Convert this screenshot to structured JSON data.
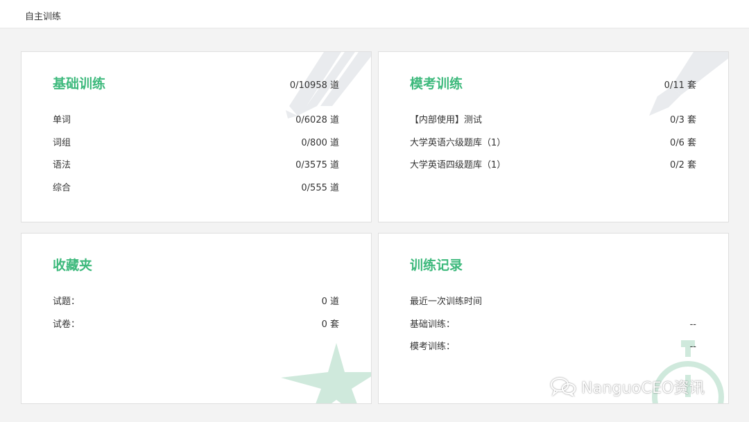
{
  "page": {
    "title": "自主训练"
  },
  "cards": {
    "basic": {
      "title": "基础训练",
      "total": "0/10958 道",
      "rows": [
        {
          "label": "单词",
          "value": "0/6028 道"
        },
        {
          "label": "词组",
          "value": "0/800 道"
        },
        {
          "label": "语法",
          "value": "0/3575 道"
        },
        {
          "label": "综合",
          "value": "0/555 道"
        }
      ]
    },
    "mock": {
      "title": "模考训练",
      "total": "0/11 套",
      "rows": [
        {
          "label": "【内部使用】测试",
          "value": "0/3 套"
        },
        {
          "label": "大学英语六级题库（1）",
          "value": "0/6 套"
        },
        {
          "label": "大学英语四级题库（1）",
          "value": "0/2 套"
        }
      ]
    },
    "favorites": {
      "title": "收藏夹",
      "rows": [
        {
          "label": "试题：",
          "value": "0 道"
        },
        {
          "label": "试卷：",
          "value": "0 套"
        }
      ]
    },
    "records": {
      "title": "训练记录",
      "rows": [
        {
          "label": "最近一次训练时间",
          "value": ""
        },
        {
          "label": "基础训练：",
          "value": "--"
        },
        {
          "label": "模考训练：",
          "value": "--"
        }
      ]
    }
  },
  "watermark": {
    "text": "NanguoCEO资讯",
    "icon": "wechat-icon"
  },
  "colors": {
    "accent": "#3db97c",
    "decoration": "#e9ebee",
    "decoration_green": "#cfe9dc",
    "background": "#f3f3f3"
  }
}
